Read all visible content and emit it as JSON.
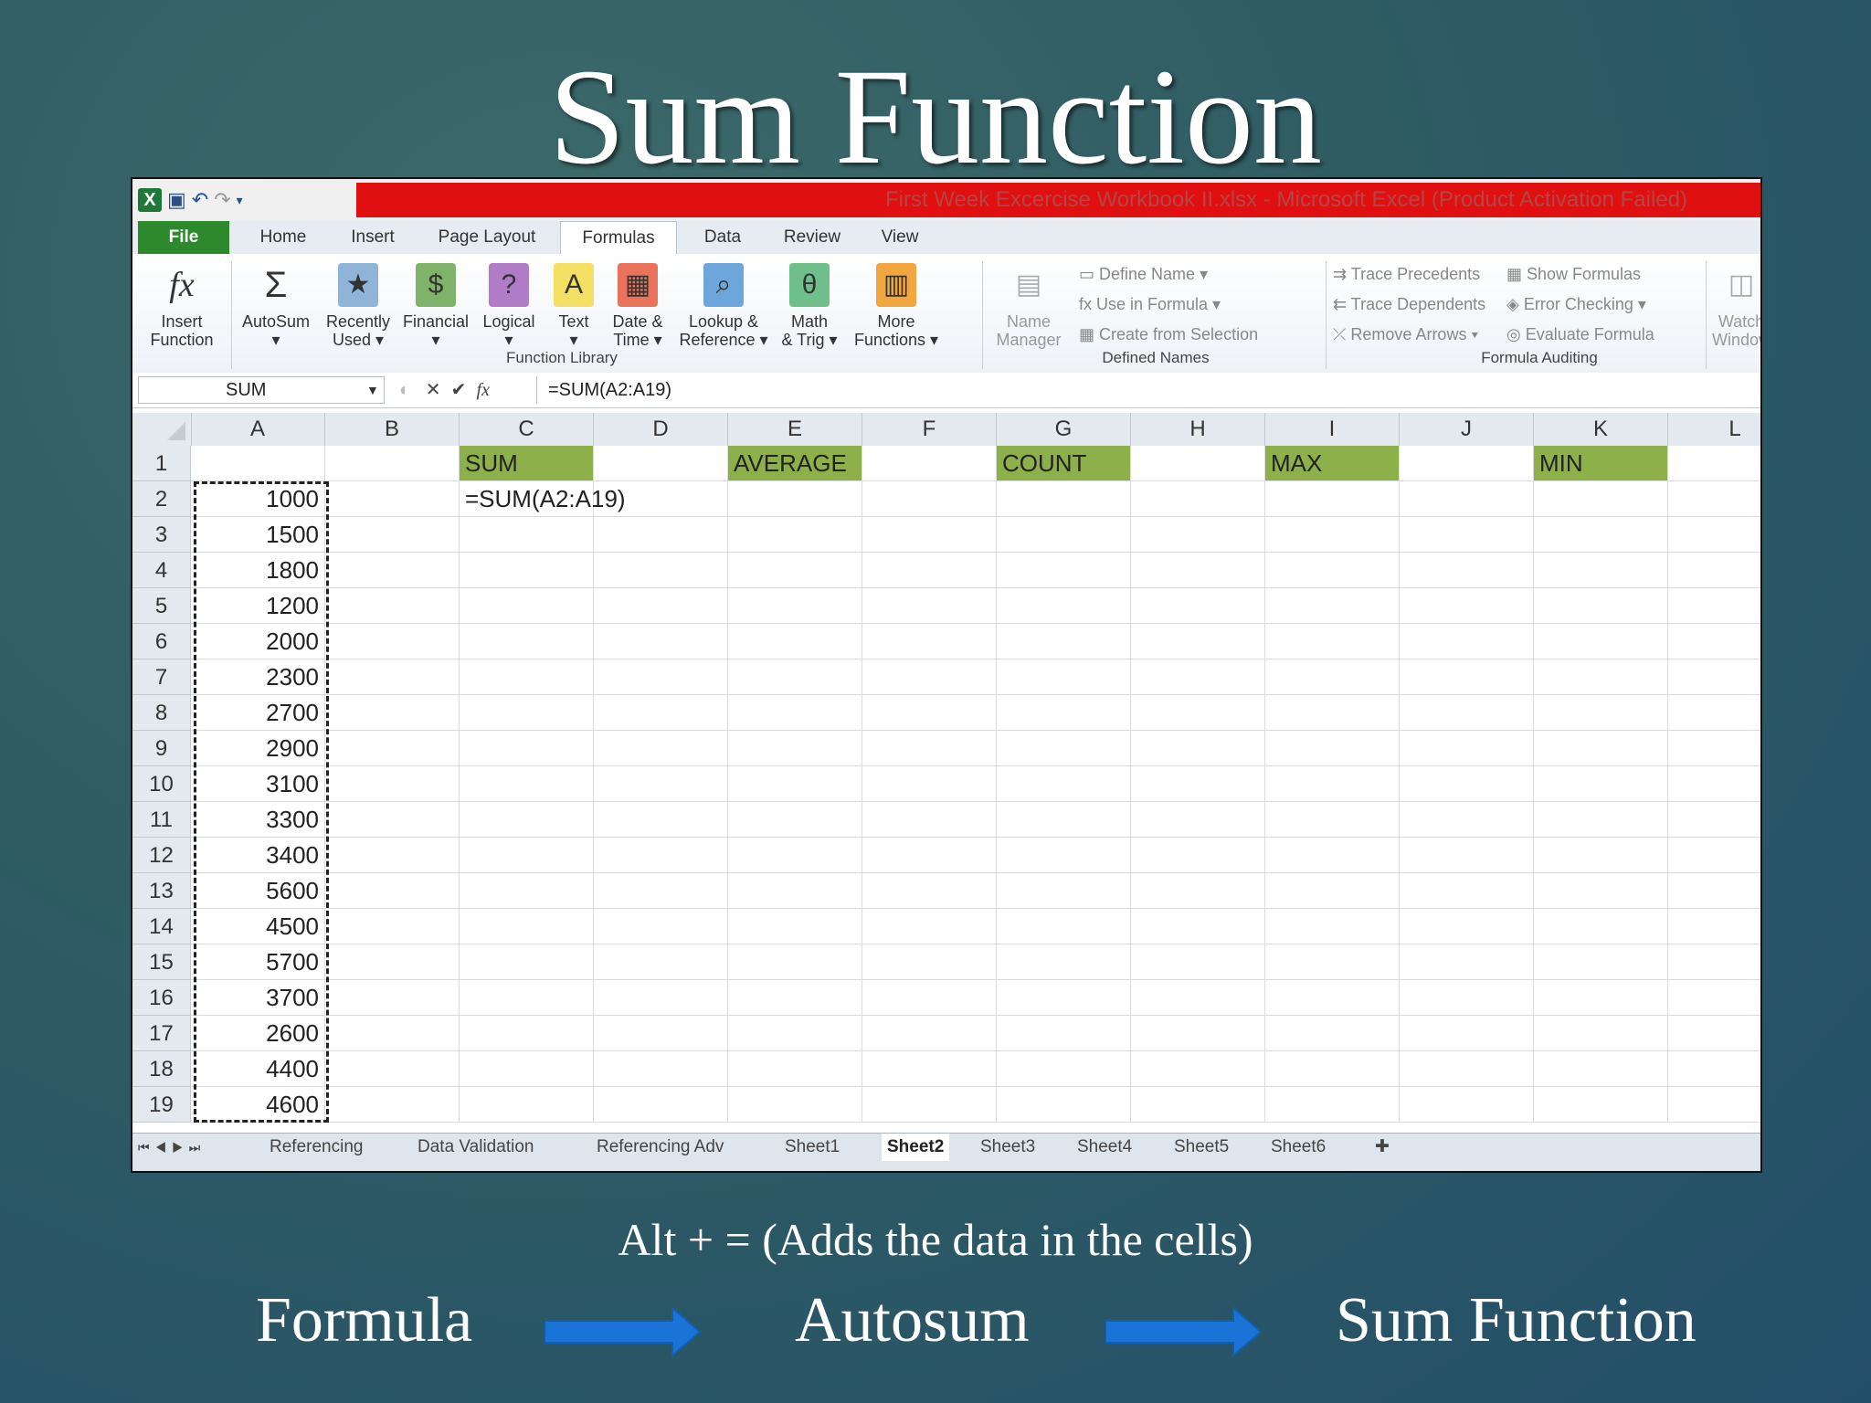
{
  "slide": {
    "title": "Sum Function",
    "shortcut_note": "Alt + = (Adds the data in the cells)",
    "flow": [
      "Formula",
      "Autosum",
      "Sum Function"
    ]
  },
  "excel": {
    "window_title": "First Week Excercise Workbook II.xlsx  -  Microsoft Excel (Product Activation Failed)",
    "tabs": [
      "File",
      "Home",
      "Insert",
      "Page Layout",
      "Formulas",
      "Data",
      "Review",
      "View"
    ],
    "active_tab": "Formulas",
    "ribbon": {
      "function_library": {
        "label": "Function Library",
        "buttons": [
          {
            "line1": "Insert",
            "line2": "Function"
          },
          {
            "line1": "AutoSum",
            "line2": "▾"
          },
          {
            "line1": "Recently",
            "line2": "Used ▾"
          },
          {
            "line1": "Financial",
            "line2": "▾"
          },
          {
            "line1": "Logical",
            "line2": "▾"
          },
          {
            "line1": "Text",
            "line2": "▾"
          },
          {
            "line1": "Date &",
            "line2": "Time ▾"
          },
          {
            "line1": "Lookup &",
            "line2": "Reference ▾"
          },
          {
            "line1": "Math",
            "line2": "& Trig ▾"
          },
          {
            "line1": "More",
            "line2": "Functions ▾"
          }
        ]
      },
      "defined_names": {
        "label": "Defined Names",
        "name_manager": {
          "line1": "Name",
          "line2": "Manager"
        },
        "items": [
          "Define Name ▾",
          "Use in Formula ▾",
          "Create from Selection"
        ]
      },
      "formula_auditing": {
        "label": "Formula Auditing",
        "items_left": [
          "Trace Precedents",
          "Trace Dependents",
          "Remove Arrows ▾"
        ],
        "items_right": [
          "Show Formulas",
          "Error Checking ▾",
          "Evaluate Formula"
        ],
        "watch": {
          "line1": "Watch",
          "line2": "Window"
        }
      }
    },
    "name_box": "SUM",
    "formula_bar": "=SUM(A2:A19)",
    "columns": [
      "A",
      "B",
      "C",
      "D",
      "E",
      "F",
      "G",
      "H",
      "I",
      "J",
      "K",
      "L"
    ],
    "row_numbers": [
      "1",
      "2",
      "3",
      "4",
      "5",
      "6",
      "7",
      "8",
      "9",
      "10",
      "11",
      "12",
      "13",
      "14",
      "15",
      "16",
      "17",
      "18",
      "19"
    ],
    "headers": {
      "C": "SUM",
      "E": "AVERAGE",
      "G": "COUNT",
      "I": "MAX",
      "K": "MIN"
    },
    "header_color": "#8db04a",
    "editing_cell": {
      "ref": "C2",
      "value": "=SUM(A2:A19)"
    },
    "column_a_values": [
      "1000",
      "1500",
      "1800",
      "1200",
      "2000",
      "2300",
      "2700",
      "2900",
      "3100",
      "3300",
      "3400",
      "5600",
      "4500",
      "5700",
      "3700",
      "2600",
      "4400",
      "4600"
    ],
    "sheet_tabs": [
      "Referencing",
      "Data Validation",
      "Referencing Adv",
      "Sheet1",
      "Sheet2",
      "Sheet3",
      "Sheet4",
      "Sheet5",
      "Sheet6"
    ],
    "active_sheet": "Sheet2"
  },
  "colors": {
    "title_bar": "#e01010",
    "file_tab": "#2c8a2c",
    "arrow": "#1a73d6"
  }
}
